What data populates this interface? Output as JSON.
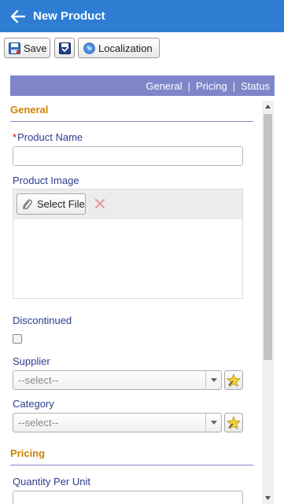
{
  "header": {
    "title": "New Product",
    "back_icon": "arrow-left-icon",
    "color": "#2e7dd3"
  },
  "toolbar": {
    "save_label": "Save",
    "save_icon": "save-icon",
    "save_close_icon": "save-close-icon",
    "localization_label": "Localization",
    "localization_icon": "globe-icon"
  },
  "tabs": [
    {
      "label": "General"
    },
    {
      "label": "Pricing"
    },
    {
      "label": "Status"
    }
  ],
  "sections": {
    "general": {
      "title": "General"
    },
    "pricing": {
      "title": "Pricing"
    }
  },
  "fields": {
    "product_name": {
      "label": "Product Name",
      "value": ""
    },
    "product_image": {
      "label": "Product Image",
      "select_file_label": "Select File"
    },
    "discontinued": {
      "label": "Discontinued",
      "checked": false
    },
    "supplier": {
      "label": "Supplier",
      "selected": "--select--"
    },
    "category": {
      "label": "Category",
      "selected": "--select--"
    },
    "quantity_per_unit": {
      "label": "Quantity Per Unit",
      "value": ""
    }
  },
  "colors": {
    "section_title": "#cc8400",
    "label": "#2d3d8f",
    "tab_bar": "#7e86c9"
  }
}
